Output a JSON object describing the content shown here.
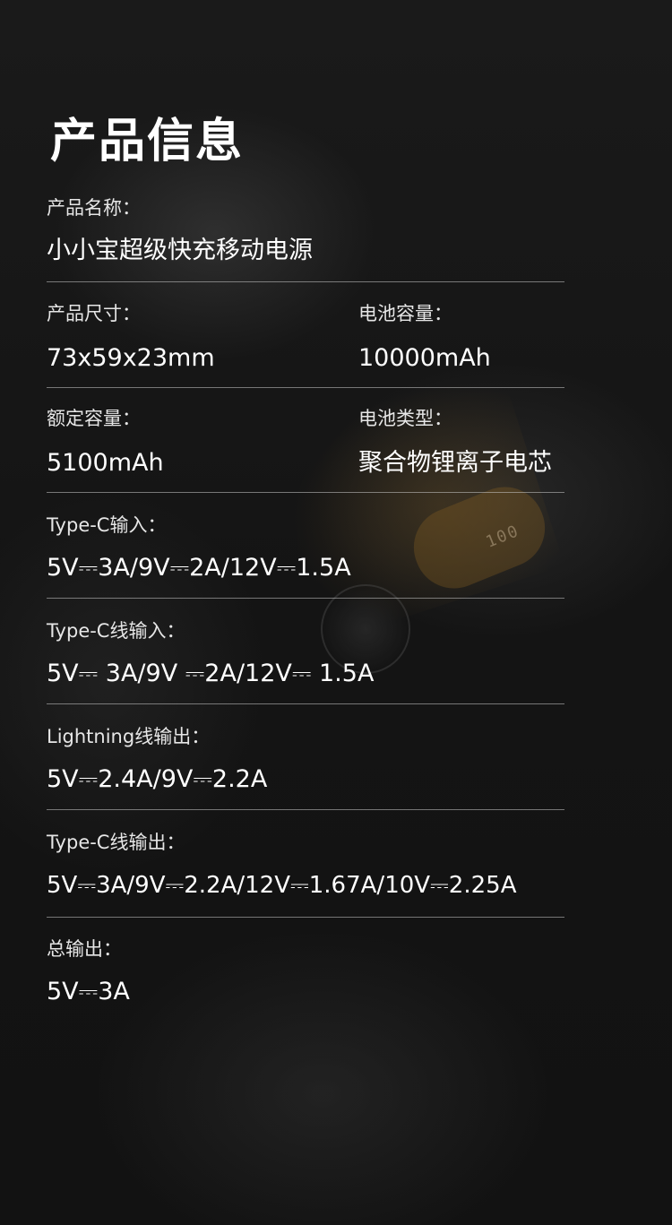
{
  "page_title": "产品信息",
  "specs": {
    "product_name": {
      "label": "产品名称：",
      "value": "小小宝超级快充移动电源"
    },
    "size": {
      "label": "产品尺寸：",
      "value": "73x59x23mm"
    },
    "battery_capacity": {
      "label": "电池容量：",
      "value": "10000mAh"
    },
    "rated_capacity": {
      "label": "额定容量：",
      "value": "5100mAh"
    },
    "battery_type": {
      "label": "电池类型：",
      "value": "聚合物锂离子电芯"
    },
    "typec_input": {
      "label": "Type-C输入：",
      "value": "5V⎓3A/9V⎓2A/12V⎓1.5A"
    },
    "typec_cable_input": {
      "label": "Type-C线输入：",
      "value": "5V⎓ 3A/9V ⎓2A/12V⎓ 1.5A"
    },
    "lightning_output": {
      "label": "Lightning线输出：",
      "value": "5V⎓2.4A/9V⎓2.2A"
    },
    "typec_cable_output": {
      "label": "Type-C线输出：",
      "value": "5V⎓3A/9V⎓2.2A/12V⎓1.67A/10V⎓2.25A"
    },
    "total_output": {
      "label": "总输出：",
      "value": "5V⎓3A"
    }
  },
  "device_display": "100"
}
